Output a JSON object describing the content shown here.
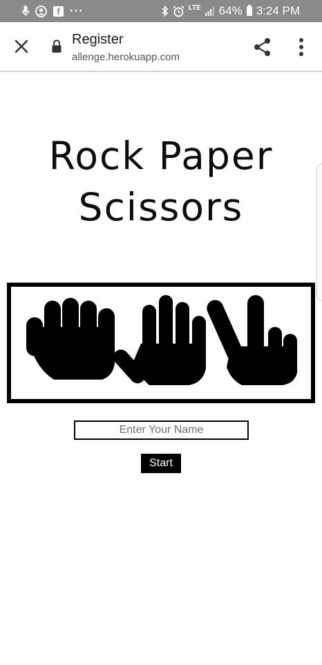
{
  "status_bar": {
    "icons": [
      "mic-icon",
      "account-circle-icon",
      "facebook-icon",
      "more-dots-icon",
      "bluetooth-icon",
      "alarm-icon",
      "lte-icon",
      "signal-icon",
      "battery-icon"
    ],
    "facebook_glyph": "f",
    "dots": "···",
    "network": "LTE",
    "battery": "64%",
    "time": "3:24 PM"
  },
  "browser": {
    "page_title": "Register",
    "url": "allenge.herokuapp.com",
    "icons": [
      "close-icon",
      "lock-icon",
      "share-icon",
      "more-vert-icon"
    ]
  },
  "page": {
    "heading_line1": "Rock Paper",
    "heading_line2": "Scissors",
    "hands": [
      "rock-hand-icon",
      "paper-hand-icon",
      "scissors-hand-icon"
    ],
    "name_input": {
      "value": "",
      "placeholder": "Enter Your Name"
    },
    "start_label": "Start"
  }
}
